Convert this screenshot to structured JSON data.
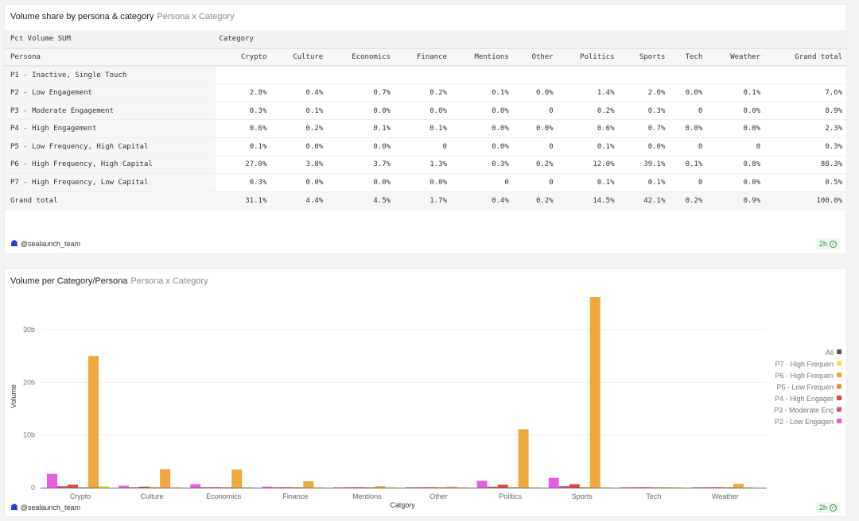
{
  "table_card": {
    "title": "Volume share by persona & category",
    "subtitle": "Persona x Category",
    "measure_label": "Pct Volume SUM",
    "column_group_label": "Category",
    "row_header": "Persona",
    "columns": [
      "Crypto",
      "Culture",
      "Economics",
      "Finance",
      "Mentions",
      "Other",
      "Politics",
      "Sports",
      "Tech",
      "Weather",
      "Grand total"
    ],
    "rows": [
      {
        "persona": "P1 - Inactive, Single Touch",
        "values": [
          "",
          "",
          "",
          "",
          "",
          "",
          "",
          "",
          "",
          "",
          ""
        ]
      },
      {
        "persona": "P2 - Low Engagement",
        "values": [
          "2.8%",
          "0.4%",
          "0.7%",
          "0.2%",
          "0.1%",
          "0.0%",
          "1.4%",
          "2.0%",
          "0.0%",
          "0.1%",
          "7.6%"
        ]
      },
      {
        "persona": "P3 - Moderate Engagement",
        "values": [
          "0.3%",
          "0.1%",
          "0.0%",
          "0.0%",
          "0.0%",
          "0",
          "0.2%",
          "0.3%",
          "0",
          "0.0%",
          "0.9%"
        ]
      },
      {
        "persona": "P4 - High Engagement",
        "values": [
          "0.6%",
          "0.2%",
          "0.1%",
          "0.1%",
          "0.0%",
          "0.0%",
          "0.6%",
          "0.7%",
          "0.0%",
          "0.0%",
          "2.3%"
        ]
      },
      {
        "persona": "P5 - Low Frequency, High Capital",
        "values": [
          "0.1%",
          "0.0%",
          "0.0%",
          "0",
          "0.0%",
          "0",
          "0.1%",
          "0.0%",
          "0",
          "0",
          "0.3%"
        ]
      },
      {
        "persona": "P6 - High Frequency, High Capital",
        "values": [
          "27.0%",
          "3.8%",
          "3.7%",
          "1.3%",
          "0.3%",
          "0.2%",
          "12.0%",
          "39.1%",
          "0.1%",
          "0.8%",
          "88.3%"
        ]
      },
      {
        "persona": "P7 - High Frequency, Low Capital",
        "values": [
          "0.3%",
          "0.0%",
          "0.0%",
          "0.0%",
          "0",
          "0",
          "0.1%",
          "0.1%",
          "0",
          "0.0%",
          "0.5%"
        ]
      },
      {
        "persona": "Grand total",
        "values": [
          "31.1%",
          "4.4%",
          "4.5%",
          "1.7%",
          "0.4%",
          "0.2%",
          "14.5%",
          "42.1%",
          "0.2%",
          "0.9%",
          "100.0%"
        ]
      }
    ],
    "footer_user": "@sealaunch_team",
    "refresh_badge": "2h"
  },
  "chart_card": {
    "title": "Volume per Category/Persona",
    "subtitle": "Persona x Category",
    "footer_user": "@sealaunch_team",
    "refresh_badge": "2h"
  },
  "chart_data": {
    "type": "bar",
    "xlabel": "Catgory",
    "ylabel": "Volume",
    "ylim": [
      0,
      38
    ],
    "yticks": [
      {
        "v": 0,
        "label": "0"
      },
      {
        "v": 10,
        "label": "10b"
      },
      {
        "v": 20,
        "label": "20b"
      },
      {
        "v": 30,
        "label": "30b"
      }
    ],
    "categories": [
      "Crypto",
      "Culture",
      "Economics",
      "Finance",
      "Mentions",
      "Other",
      "Politics",
      "Sports",
      "Tech",
      "Weather"
    ],
    "legend_position": "right",
    "legend_all": {
      "label": "All",
      "color": "#555555"
    },
    "series": [
      {
        "name": "P2 - Low Engagen",
        "color": "#e85de0",
        "values": [
          2.6,
          0.37,
          0.65,
          0.19,
          0.09,
          0,
          1.3,
          1.85,
          0,
          0.09
        ]
      },
      {
        "name": "P3 - Moderate Enç",
        "color": "#d4508e",
        "values": [
          0.28,
          0.09,
          0,
          0,
          0,
          0,
          0.19,
          0.28,
          0,
          0
        ]
      },
      {
        "name": "P4 - High Engager",
        "color": "#d9483f",
        "values": [
          0.56,
          0.19,
          0.09,
          0.09,
          0,
          0,
          0.56,
          0.65,
          0,
          0
        ]
      },
      {
        "name": "P5 - Low Frequen",
        "color": "#e0913a",
        "values": [
          0.09,
          0,
          0,
          0,
          0,
          0,
          0.09,
          0,
          0,
          0
        ]
      },
      {
        "name": "P6 - High Frequen",
        "color": "#f0a83c",
        "values": [
          25.0,
          3.52,
          3.43,
          1.2,
          0.28,
          0.19,
          11.1,
          36.2,
          0.09,
          0.74
        ]
      },
      {
        "name": "P7 - High Frequen",
        "color": "#f3df48",
        "values": [
          0.28,
          0,
          0,
          0,
          0,
          0,
          0.09,
          0.09,
          0,
          0
        ]
      }
    ]
  }
}
